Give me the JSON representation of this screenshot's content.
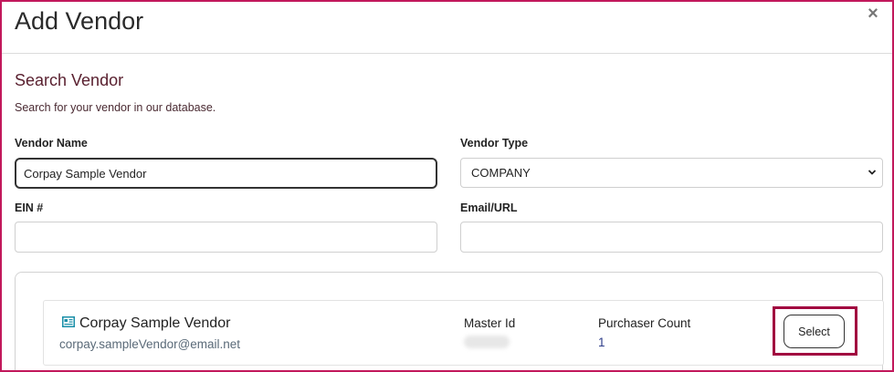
{
  "modal": {
    "title": "Add Vendor",
    "close_icon": "close-icon"
  },
  "search": {
    "section_title": "Search Vendor",
    "description": "Search for your vendor in our database."
  },
  "fields": {
    "vendor_name_label": "Vendor Name",
    "vendor_name_value": "Corpay Sample Vendor",
    "vendor_type_label": "Vendor Type",
    "vendor_type_value": "COMPANY",
    "ein_label": "EIN #",
    "ein_value": "",
    "email_label": "Email/URL",
    "email_value": ""
  },
  "result": {
    "icon": "vendor-card-icon",
    "vendor_name": "Corpay Sample Vendor",
    "vendor_email": "corpay.sampleVendor@email.net",
    "master_id_label": "Master Id",
    "purchaser_count_label": "Purchaser Count",
    "purchaser_count_value": "1",
    "select_label": "Select"
  },
  "colors": {
    "border_accent": "#c2185b",
    "highlight": "#a1003f",
    "link_blue": "#2e3d8a"
  }
}
